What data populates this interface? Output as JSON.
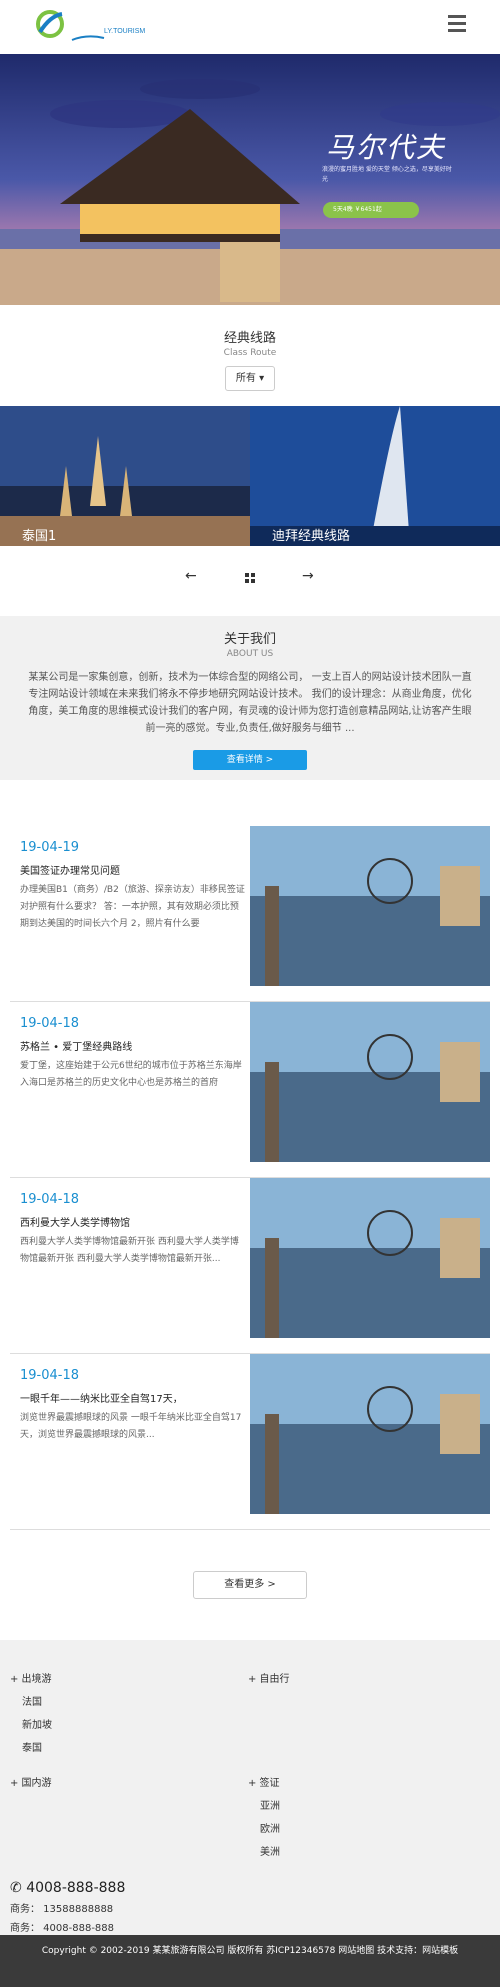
{
  "header": {
    "logo_text": "LY.TOURISM",
    "menu_icon": "hamburger-menu-icon"
  },
  "hero": {
    "title": "马尔代夫",
    "desc": "浪漫的蜜月胜地 爱的天堂 倾心之选，尽享美好时光",
    "pill": "5天4晚 ￥6451起"
  },
  "route": {
    "title": "经典线路",
    "subtitle": "Class Route",
    "filter_label": "所有",
    "cards": [
      {
        "label": "泰国1"
      },
      {
        "label": "迪拜经典线路"
      }
    ],
    "prev_icon": "arrow-left-icon",
    "next_icon": "arrow-right-icon"
  },
  "about": {
    "title": "关于我们",
    "subtitle": "ABOUT US",
    "text": "某某公司是一家集创意，创新，技术为一体综合型的网络公司， 一支上百人的网站设计技术团队一直专注网站设计领域在未来我们将永不停步地研究网站设计技术。 我们的设计理念：从商业角度，优化角度，美工角度的思维模式设计我们的客户网，有灵魂的设计师为您打造创意精品网站,让访客产生眼前一亮的感觉。专业,负责任,做好服务与细节 ...",
    "button": "查看详情 >"
  },
  "news": [
    {
      "date": "19-04-19",
      "title": "美国签证办理常见问题",
      "desc": "办理美国B1（商务）/B2（旅游、探亲访友）非移民签证对护照有什么要求？ 答：一本护照，其有效期必须比预期到达美国的时间长六个月 2，照片有什么要"
    },
    {
      "date": "19-04-18",
      "title": "苏格兰 • 爱丁堡经典路线",
      "desc": "爱丁堡，这座始建于公元6世纪的城市位于苏格兰东海岸入海口是苏格兰的历史文化中心也是苏格兰的首府"
    },
    {
      "date": "19-04-18",
      "title": "西利曼大学人类学博物馆",
      "desc": "西利曼大学人类学博物馆最新开张 西利曼大学人类学博物馆最新开张 西利曼大学人类学博物馆最新开张..."
    },
    {
      "date": "19-04-18",
      "title": "一眼千年——纳米比亚全自驾17天，",
      "desc": "浏览世界最震撼眼球的风景 一眼千年纳米比亚全自驾17天，浏览世界最震撼眼球的风景..."
    }
  ],
  "more_button": "查看更多 >",
  "footer": {
    "col1": {
      "head": "+ 出境游",
      "items": [
        "法国",
        "新加坡",
        "泰国"
      ]
    },
    "col2": {
      "head": "+ 自由行",
      "items": []
    },
    "col3": {
      "head": "+ 国内游",
      "items": []
    },
    "col4": {
      "head": "+ 签证",
      "items": [
        "亚洲",
        "欧洲",
        "美洲"
      ]
    },
    "phone_big": "4008-888-888",
    "mobile_line": "商务： 13588888888",
    "tel_line": "商务： 4008-888-888"
  },
  "copyright": "Copyright © 2002-2019 某某旅游有限公司 版权所有   苏ICP12346578   网站地图   技术支持：网站模板"
}
